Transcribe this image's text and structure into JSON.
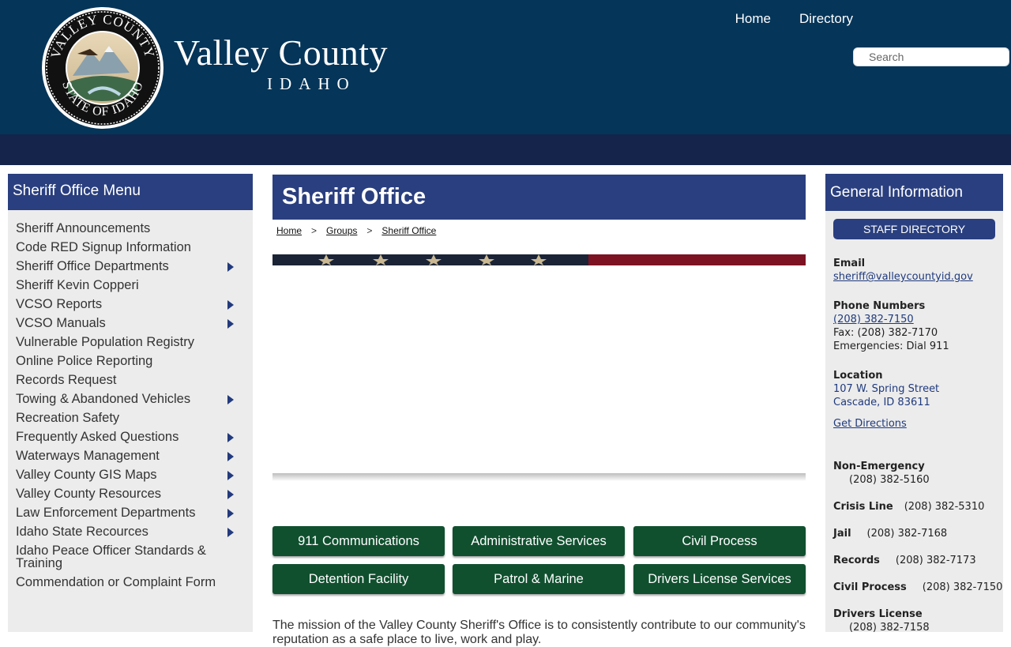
{
  "header": {
    "seal": {
      "top_text": "VALLEY COUNTY",
      "bottom_text": "STATE OF IDAHO"
    },
    "title": "Valley County",
    "subtitle": "IDAHO",
    "nav": [
      "Home",
      "Directory"
    ],
    "search_placeholder": "Search"
  },
  "sidebar": {
    "title": "Sheriff Office Menu",
    "items": [
      {
        "label": "Sheriff Announcements",
        "submenu": false
      },
      {
        "label": "Code RED Signup Information",
        "submenu": false
      },
      {
        "label": "Sheriff Office Departments",
        "submenu": true
      },
      {
        "label": "Sheriff Kevin Copperi",
        "submenu": false
      },
      {
        "label": "VCSO Reports",
        "submenu": true
      },
      {
        "label": "VCSO Manuals",
        "submenu": true
      },
      {
        "label": "Vulnerable Population Registry",
        "submenu": false
      },
      {
        "label": "Online Police Reporting",
        "submenu": false
      },
      {
        "label": "Records Request",
        "submenu": false
      },
      {
        "label": "Towing & Abandoned Vehicles",
        "submenu": true
      },
      {
        "label": "Recreation Safety",
        "submenu": false
      },
      {
        "label": "Frequently Asked Questions",
        "submenu": true
      },
      {
        "label": "Waterways Management",
        "submenu": true
      },
      {
        "label": "Valley County GIS Maps",
        "submenu": true
      },
      {
        "label": "Valley County Resources",
        "submenu": true
      },
      {
        "label": "Law Enforcement Departments",
        "submenu": true
      },
      {
        "label": "Idaho State Recources",
        "submenu": true
      },
      {
        "label": "Idaho Peace Officer Standards & Training",
        "submenu": false
      },
      {
        "label": "Commendation or Complaint Form",
        "submenu": false
      }
    ]
  },
  "main": {
    "title": "Sheriff Office",
    "breadcrumb": [
      "Home",
      "Groups",
      "Sheriff Office"
    ],
    "breadcrumb_separator": ">",
    "buttons": [
      "911 Communications",
      "Administrative Services",
      "Civil Process",
      "Detention Facility",
      "Patrol & Marine",
      "Drivers License Services"
    ],
    "mission": "The mission of the Valley County Sheriff's Office is to consistently contribute to our community's reputation as a safe place to live, work and play."
  },
  "info": {
    "title": "General Information",
    "staff_button": "STAFF DIRECTORY",
    "email_label": "Email",
    "email": "sheriff@valleycountyid.gov",
    "phone_label": "Phone Numbers",
    "phone": "(208) 382-7150",
    "fax": "Fax: (208) 382-7170",
    "emergencies": "Emergencies: Dial 911",
    "location_label": "Location",
    "address1": "107 W. Spring Street",
    "address2": "Cascade, ID 83611",
    "directions": "Get Directions",
    "contacts": [
      {
        "label": "Non-Emergency",
        "number": "(208) 382-5160"
      },
      {
        "label": "Crisis Line",
        "number": "(208) 382-5310"
      },
      {
        "label": "Jail",
        "number": "(208) 382-7168"
      },
      {
        "label": "Records",
        "number": "(208) 382-7173"
      },
      {
        "label": "Civil Process",
        "number": "(208) 382-7150"
      },
      {
        "label": "Drivers License",
        "number": "(208) 382-7158"
      }
    ]
  },
  "colors": {
    "header_bg": "#053559",
    "nav_bar": "#15244a",
    "panel_blue": "#2a3f7f",
    "button_green": "#10502f",
    "flag_red": "#7d1222"
  }
}
